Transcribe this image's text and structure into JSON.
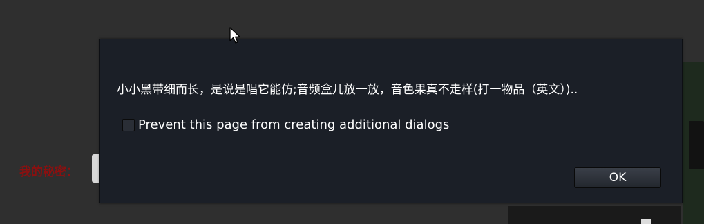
{
  "background": {
    "label": "我的秘密：",
    "label_color": "#8b1010"
  },
  "dialog": {
    "message": "小小黑带细而长，是说是唱它能仿;音频盒儿放一放，音色果真不走样(打一物品（英文）)..",
    "checkbox": {
      "label": "Prevent this page from creating additional dialogs",
      "checked": false
    },
    "ok_label": "OK",
    "background_color": "#1b1f27"
  },
  "icons": {
    "cursor": "mouse-pointer-icon"
  }
}
